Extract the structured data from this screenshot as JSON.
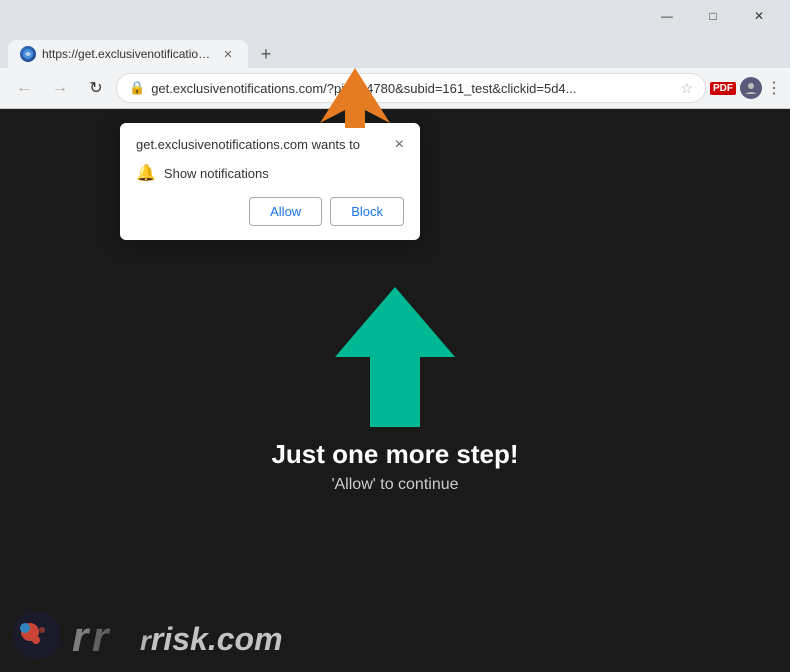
{
  "titlebar": {
    "minimize": "—",
    "maximize": "□",
    "close": "✕"
  },
  "tab": {
    "favicon_alt": "site-icon",
    "title": "https://get.exclusivenotifications...",
    "close": "✕",
    "new_tab": "+"
  },
  "navbar": {
    "back": "←",
    "forward": "→",
    "refresh": "↻",
    "address": "get.exclusivenotifications.com/?pid=54780&subid=161_test&clickid=5d4...",
    "lock_icon": "🔒",
    "star_icon": "☆",
    "pdf_label": "PDF",
    "menu_icon": "⋮"
  },
  "popup": {
    "title": "get.exclusivenotifications.com wants to",
    "close_icon": "×",
    "row_icon": "🔔",
    "row_text": "Show notifications",
    "allow_label": "Allow",
    "block_label": "Block"
  },
  "page": {
    "heading": "Just one more step!",
    "subtext": "'Allow' to continue"
  },
  "watermark": {
    "text_part1": "r",
    "brand": "risk.com"
  }
}
